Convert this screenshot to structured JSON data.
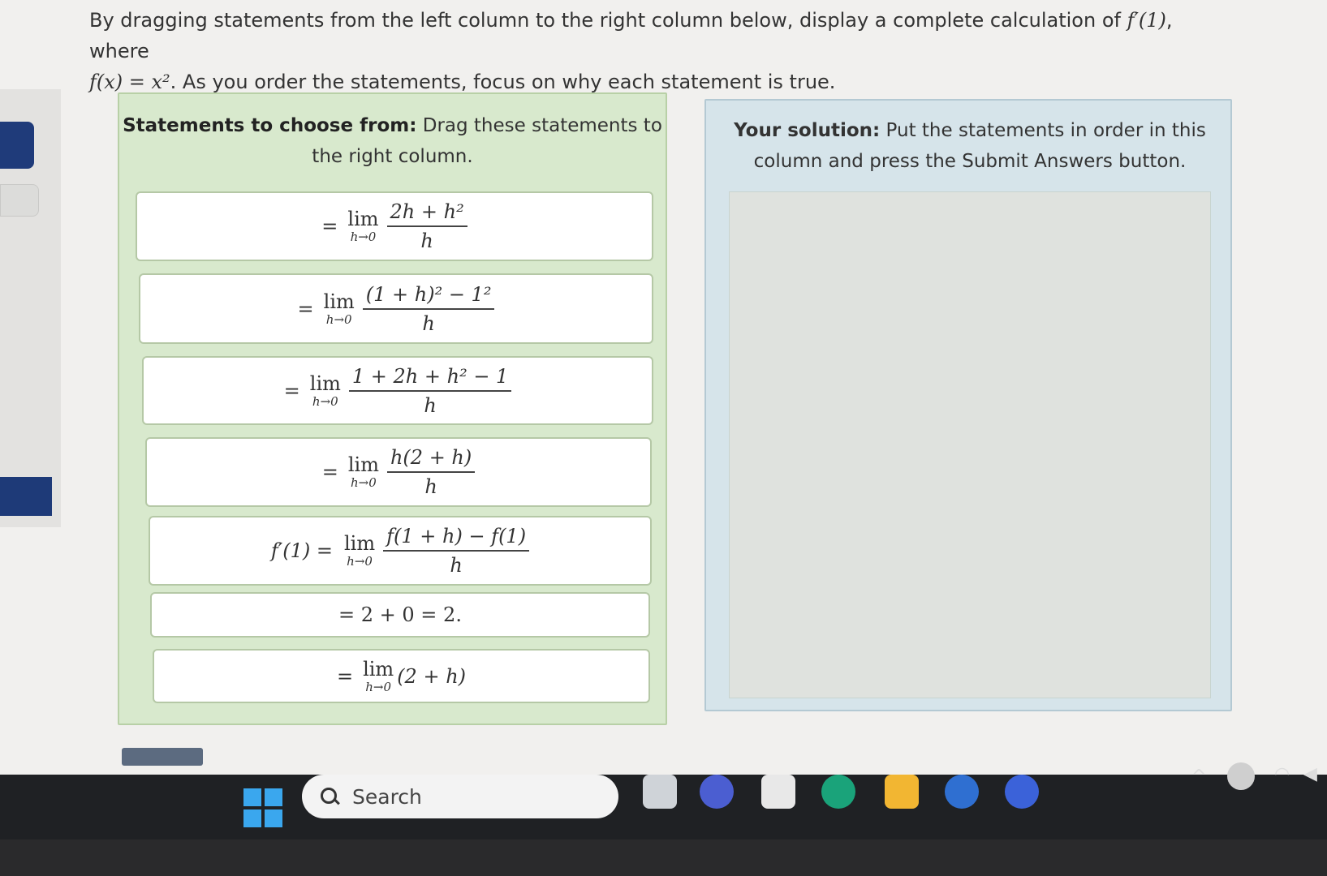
{
  "instructions": {
    "line1_text": "By dragging statements from the left column to the right column below, display a complete calculation of ",
    "line1_math": "f′(1)",
    "line1_end": ", where",
    "line2_math": "f(x) = x²",
    "line2_text": ". As you order the statements, focus on why each statement is true."
  },
  "left_panel": {
    "header_bold": "Statements to choose from:",
    "header_text": " Drag these statements to the right column."
  },
  "statements": [
    {
      "prefix": "=",
      "lim": "lim",
      "sub": "h→0",
      "num": "2h + h²",
      "den": "h"
    },
    {
      "prefix": "=",
      "lim": "lim",
      "sub": "h→0",
      "num": "(1 + h)² − 1²",
      "den": "h"
    },
    {
      "prefix": "=",
      "lim": "lim",
      "sub": "h→0",
      "num": "1 + 2h + h² − 1",
      "den": "h"
    },
    {
      "prefix": "=",
      "lim": "lim",
      "sub": "h→0",
      "num": "h(2 + h)",
      "den": "h"
    },
    {
      "prefix": "f′(1) =",
      "lim": "lim",
      "sub": "h→0",
      "num": "f(1 + h) − f(1)",
      "den": "h"
    },
    {
      "text": "= 2 + 0 = 2."
    },
    {
      "prefix": "=",
      "lim": "lim",
      "sub": "h→0",
      "tail": "(2 + h)"
    }
  ],
  "right_panel": {
    "header_bold": "Your solution:",
    "header_text": " Put the statements in order in this column and press the Submit Answers button."
  },
  "taskbar": {
    "search_label": "Search"
  }
}
